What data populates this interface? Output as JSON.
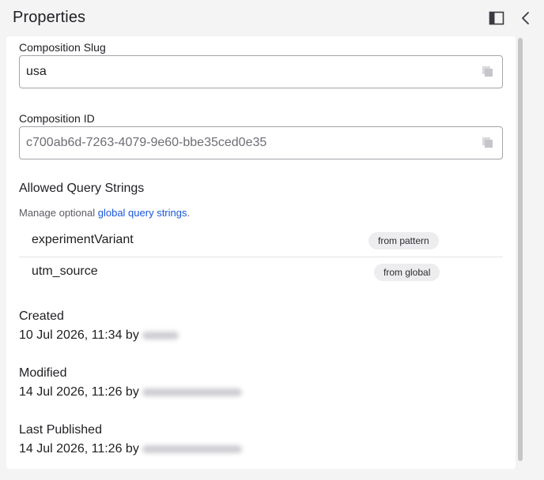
{
  "header": {
    "title": "Properties",
    "icons": [
      "panel-toggle-icon",
      "chevron-left-icon"
    ]
  },
  "composition_slug": {
    "label": "Composition Slug",
    "value": "usa",
    "copy_icon": "copy-icon"
  },
  "composition_id": {
    "label": "Composition ID",
    "value": "c700ab6d-7263-4079-9e60-bbe35ced0e35",
    "copy_icon": "copy-icon"
  },
  "query_strings": {
    "title": "Allowed Query Strings",
    "help_prefix": "Manage optional ",
    "help_link": "global query strings",
    "help_suffix": ".",
    "items": [
      {
        "name": "experimentVariant",
        "source": "from pattern"
      },
      {
        "name": "utm_source",
        "source": "from global"
      }
    ]
  },
  "metadata": {
    "created": {
      "label": "Created",
      "date": "10 Jul 2026, 11:34 by"
    },
    "modified": {
      "label": "Modified",
      "date": "14 Jul 2026, 11:26 by"
    },
    "published": {
      "label": "Last Published",
      "date": "14 Jul 2026, 11:26 by"
    }
  },
  "colors": {
    "link": "#1a56db",
    "background": "#f4f4f5",
    "panel": "#ffffff",
    "badge": "#ededf0"
  }
}
